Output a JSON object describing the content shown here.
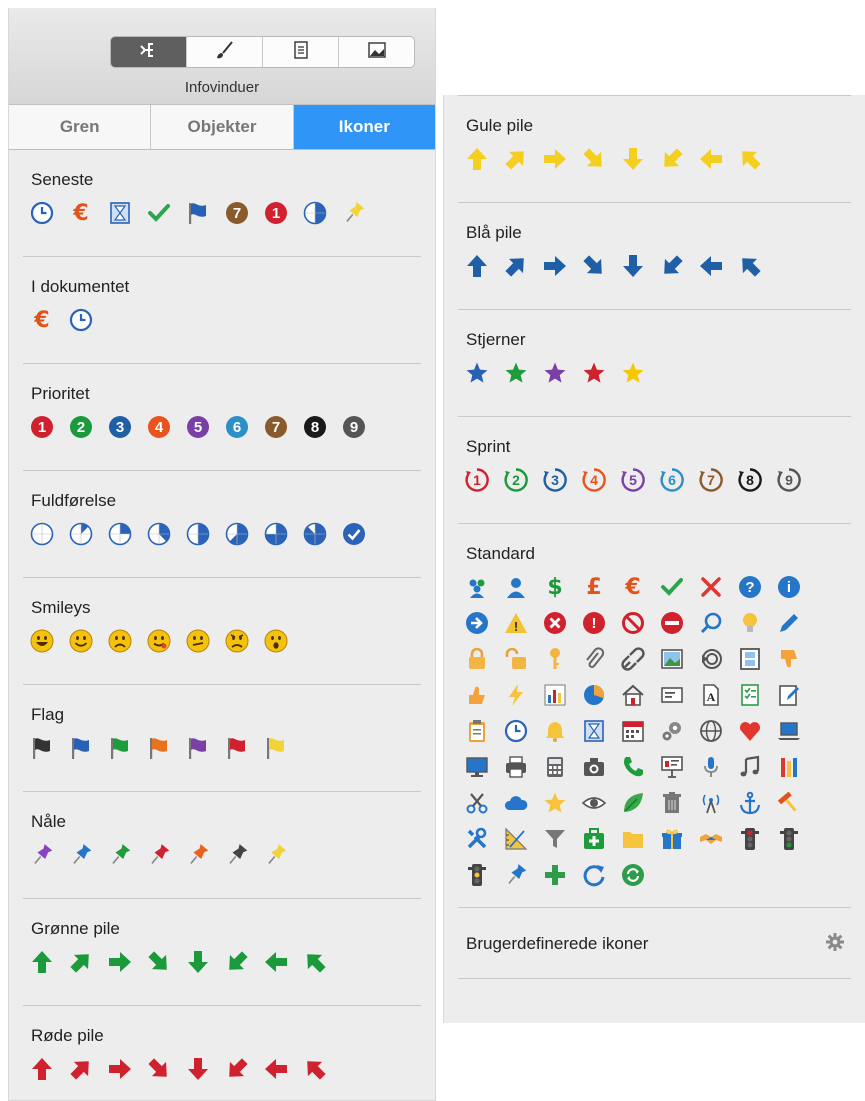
{
  "toolbar": {
    "label": "Infovinduer",
    "buttons": [
      {
        "name": "mindmap-icon",
        "active": true
      },
      {
        "name": "brush-icon",
        "active": false
      },
      {
        "name": "notes-icon",
        "active": false
      },
      {
        "name": "image-icon",
        "active": false
      }
    ]
  },
  "tabs": [
    {
      "label": "Gren",
      "active": false
    },
    {
      "label": "Objekter",
      "active": false
    },
    {
      "label": "Ikoner",
      "active": true
    }
  ],
  "left_sections": [
    {
      "title": "Seneste",
      "icons": [
        "clock-icon",
        "euro-icon",
        "hourglass-icon",
        "check-icon",
        "flag-blue-icon",
        "priority-7-icon",
        "priority-1-icon",
        "completion-half-icon",
        "pin-yellow-icon"
      ]
    },
    {
      "title": "I dokumentet",
      "icons": [
        "euro-icon",
        "clock-icon"
      ]
    },
    {
      "title": "Prioritet",
      "icons": [
        "priority-1-icon",
        "priority-2-icon",
        "priority-3-icon",
        "priority-4-icon",
        "priority-5-icon",
        "priority-6-icon",
        "priority-7-icon",
        "priority-8-icon",
        "priority-9-icon"
      ]
    },
    {
      "title": "Fuldførelse",
      "icons": [
        "completion-0-icon",
        "completion-1-icon",
        "completion-2-icon",
        "completion-3-icon",
        "completion-4-icon",
        "completion-5-icon",
        "completion-6-icon",
        "completion-7-icon",
        "completion-done-icon"
      ]
    },
    {
      "title": "Smileys",
      "icons": [
        "smiley-laugh-icon",
        "smiley-happy-icon",
        "smiley-sad-icon",
        "smiley-wink-icon",
        "smiley-meh-icon",
        "smiley-angry-icon",
        "smiley-surprised-icon"
      ]
    },
    {
      "title": "Flag",
      "icons": [
        "flag-black-icon",
        "flag-blue-icon",
        "flag-green-icon",
        "flag-orange-icon",
        "flag-purple-icon",
        "flag-red-icon",
        "flag-yellow-icon"
      ]
    },
    {
      "title": "Nåle",
      "icons": [
        "pin-purple-icon",
        "pin-blue-icon",
        "pin-green-icon",
        "pin-red-icon",
        "pin-orange-icon",
        "pin-black-icon",
        "pin-yellow-icon"
      ]
    },
    {
      "title": "Grønne pile",
      "icons": [
        "arrow-green-up-icon",
        "arrow-green-up-right-icon",
        "arrow-green-right-icon",
        "arrow-green-down-right-icon",
        "arrow-green-down-icon",
        "arrow-green-down-left-icon",
        "arrow-green-left-icon",
        "arrow-green-up-left-icon"
      ]
    },
    {
      "title": "Røde pile",
      "icons": [
        "arrow-red-up-icon",
        "arrow-red-up-right-icon",
        "arrow-red-right-icon",
        "arrow-red-down-right-icon",
        "arrow-red-down-icon",
        "arrow-red-down-left-icon",
        "arrow-red-left-icon",
        "arrow-red-up-left-icon"
      ]
    }
  ],
  "right_sections": [
    {
      "title": "Gule pile",
      "icons": [
        "arrow-yellow-up-icon",
        "arrow-yellow-up-right-icon",
        "arrow-yellow-right-icon",
        "arrow-yellow-down-right-icon",
        "arrow-yellow-down-icon",
        "arrow-yellow-down-left-icon",
        "arrow-yellow-left-icon",
        "arrow-yellow-up-left-icon"
      ]
    },
    {
      "title": "Blå pile",
      "icons": [
        "arrow-blue-up-icon",
        "arrow-blue-up-right-icon",
        "arrow-blue-right-icon",
        "arrow-blue-down-right-icon",
        "arrow-blue-down-icon",
        "arrow-blue-down-left-icon",
        "arrow-blue-left-icon",
        "arrow-blue-up-left-icon"
      ]
    },
    {
      "title": "Stjerner",
      "icons": [
        "star-blue-icon",
        "star-green-icon",
        "star-purple-icon",
        "star-red-icon",
        "star-yellow-icon"
      ]
    },
    {
      "title": "Sprint",
      "icons": [
        "sprint-1-icon",
        "sprint-2-icon",
        "sprint-3-icon",
        "sprint-4-icon",
        "sprint-5-icon",
        "sprint-6-icon",
        "sprint-7-icon",
        "sprint-8-icon",
        "sprint-9-icon"
      ]
    },
    {
      "title": "Standard",
      "icons": [
        "group-icon",
        "user-icon",
        "dollar-icon",
        "pound-icon",
        "euro-icon",
        "check-icon",
        "cross-icon",
        "question-icon",
        "info-icon",
        "arrow-circle-icon",
        "warning-icon",
        "error-icon",
        "exclamation-icon",
        "forbidden-icon",
        "no-entry-icon",
        "search-icon",
        "lightbulb-icon",
        "pencil-icon",
        "lock-icon",
        "unlock-icon",
        "key-icon",
        "paperclip-icon",
        "link-broken-icon",
        "picture-icon",
        "audio-icon",
        "film-icon",
        "thumbs-down-icon",
        "thumbs-up-icon",
        "lightning-icon",
        "bar-chart-icon",
        "pie-chart-icon",
        "house-icon",
        "id-card-icon",
        "document-icon",
        "checklist-icon",
        "edit-note-icon",
        "clipboard-icon",
        "clock-icon",
        "bell-icon",
        "hourglass-icon",
        "calendar-icon",
        "gears-icon",
        "globe-icon",
        "heart-icon",
        "laptop-icon",
        "monitor-icon",
        "printer-icon",
        "calculator-icon",
        "camera-icon",
        "phone-icon",
        "presentation-icon",
        "microphone-icon",
        "music-icon",
        "pencils-icon",
        "scissors-icon",
        "cloud-icon",
        "star-icon",
        "eye-icon",
        "leaf-icon",
        "trash-icon",
        "antenna-icon",
        "anchor-icon",
        "hammer-icon",
        "tools-icon",
        "ruler-icon",
        "filter-icon",
        "medkit-icon",
        "folder-icon",
        "gift-icon",
        "handshake-icon",
        "traffic-light-red-icon",
        "traffic-light-green-icon",
        "traffic-light-yellow-icon",
        "pin-icon",
        "plus-icon",
        "refresh-icon",
        "sync-icon"
      ]
    }
  ],
  "footer": {
    "label": "Brugerdefinerede ikoner",
    "icon": "gear-icon"
  },
  "colors": {
    "accent": "#2f95f6",
    "green": "#1a9a3a",
    "red": "#d0212f",
    "yellow": "#f5c800",
    "blue": "#1f5fa6",
    "panel": "#ededed"
  }
}
